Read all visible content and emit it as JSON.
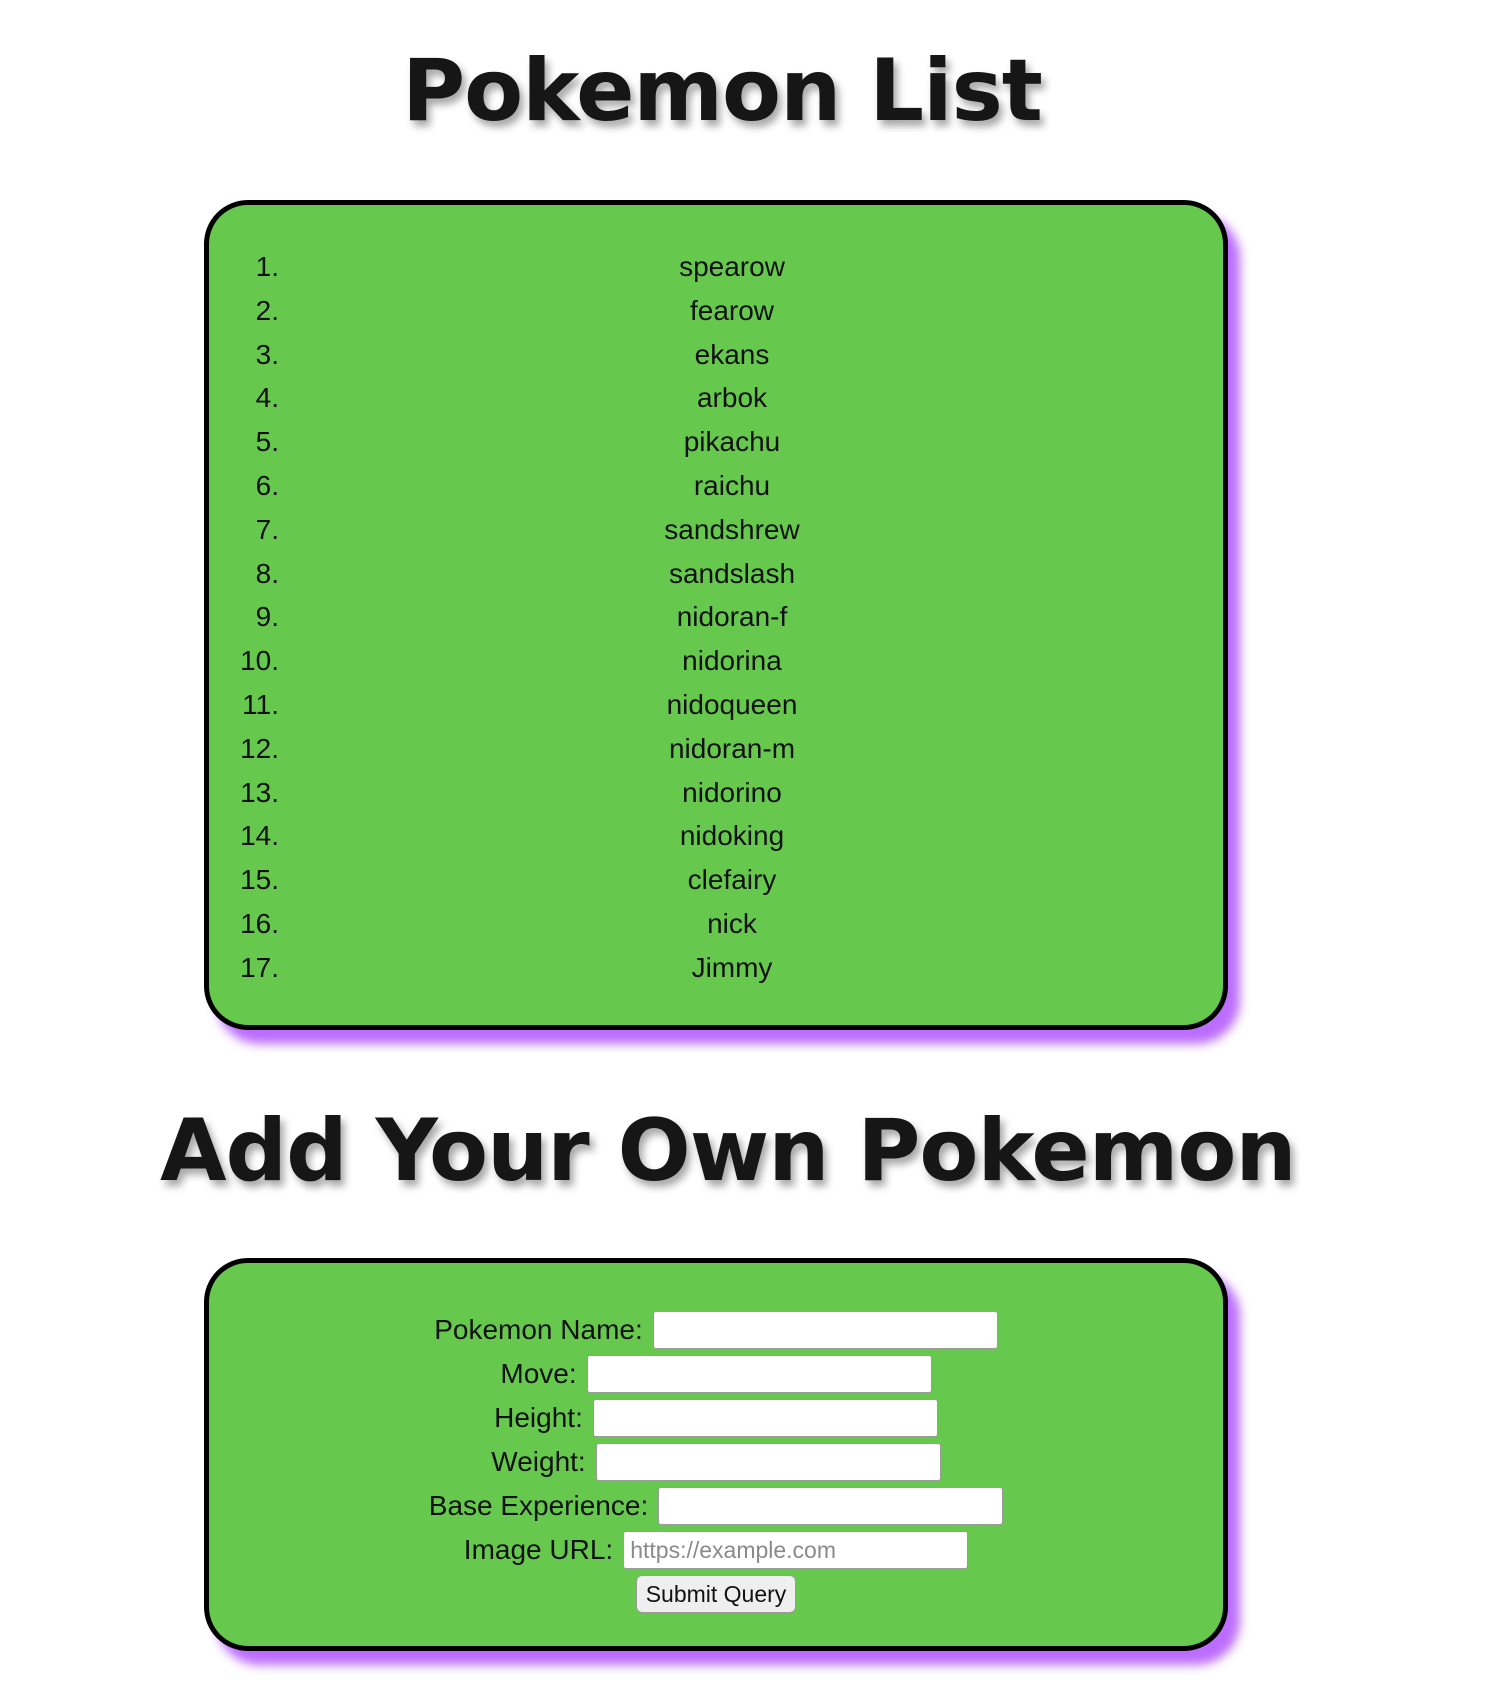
{
  "list_section": {
    "title": "Pokemon List",
    "items": [
      {
        "number": "1.",
        "name": "spearow"
      },
      {
        "number": "2.",
        "name": "fearow"
      },
      {
        "number": "3.",
        "name": "ekans"
      },
      {
        "number": "4.",
        "name": "arbok"
      },
      {
        "number": "5.",
        "name": "pikachu"
      },
      {
        "number": "6.",
        "name": "raichu"
      },
      {
        "number": "7.",
        "name": "sandshrew"
      },
      {
        "number": "8.",
        "name": "sandslash"
      },
      {
        "number": "9.",
        "name": "nidoran-f"
      },
      {
        "number": "10.",
        "name": "nidorina"
      },
      {
        "number": "11.",
        "name": "nidoqueen"
      },
      {
        "number": "12.",
        "name": "nidoran-m"
      },
      {
        "number": "13.",
        "name": "nidorino"
      },
      {
        "number": "14.",
        "name": "nidoking"
      },
      {
        "number": "15.",
        "name": "clefairy"
      },
      {
        "number": "16.",
        "name": "nick"
      },
      {
        "number": "17.",
        "name": "Jimmy"
      }
    ]
  },
  "form_section": {
    "title": "Add Your Own Pokemon",
    "fields": {
      "name": {
        "label": "Pokemon Name:",
        "value": "",
        "placeholder": ""
      },
      "move": {
        "label": "Move:",
        "value": "",
        "placeholder": ""
      },
      "height": {
        "label": "Height:",
        "value": "",
        "placeholder": ""
      },
      "weight": {
        "label": "Weight:",
        "value": "",
        "placeholder": ""
      },
      "base_experience": {
        "label": "Base Experience:",
        "value": "",
        "placeholder": ""
      },
      "image_url": {
        "label": "Image URL:",
        "value": "",
        "placeholder": "https://example.com"
      }
    },
    "submit_label": "Submit Query"
  },
  "colors": {
    "card_background": "#66c94d",
    "card_border": "#000000",
    "card_shadow": "#b054ff",
    "heading_text": "#161616"
  }
}
